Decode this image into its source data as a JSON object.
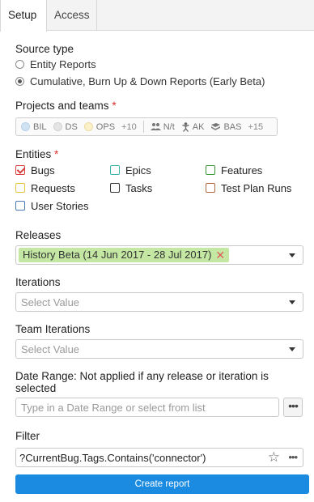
{
  "tabs": [
    {
      "label": "Setup"
    },
    {
      "label": "Access"
    }
  ],
  "source_type": {
    "label": "Source type",
    "options": [
      {
        "label": "Entity Reports",
        "checked": false
      },
      {
        "label": "Cumulative, Burn Up & Down Reports (Early Beta)",
        "checked": true
      }
    ]
  },
  "projects": {
    "label": "Projects and teams",
    "required_mark": "*",
    "items": [
      {
        "label": "BIL",
        "color": "#cfe3f5"
      },
      {
        "label": "DS",
        "color": "#e2e2e2"
      },
      {
        "label": "OPS",
        "color": "#fbf0c8"
      }
    ],
    "more_projects": "+10",
    "teams": [
      {
        "label": "N/t",
        "icon": "team-icon"
      },
      {
        "label": "AK",
        "icon": "person-icon"
      },
      {
        "label": "BAS",
        "icon": "book-icon"
      }
    ],
    "more_teams": "+15"
  },
  "entities": {
    "label": "Entities",
    "required_mark": "*",
    "items": [
      {
        "label": "Bugs",
        "color": "#d94141",
        "checked": true
      },
      {
        "label": "Epics",
        "color": "#3ab6a8",
        "checked": false
      },
      {
        "label": "Features",
        "color": "#3a9a3a",
        "checked": false
      },
      {
        "label": "Requests",
        "color": "#e8c43a",
        "checked": false
      },
      {
        "label": "Tasks",
        "color": "#333333",
        "checked": false
      },
      {
        "label": "Test Plan Runs",
        "color": "#b06a3a",
        "checked": false
      },
      {
        "label": "User Stories",
        "color": "#4a7ab8",
        "checked": false
      }
    ]
  },
  "releases": {
    "label": "Releases",
    "selected": "History Beta (14 Jun 2017 - 28 Jul 2017)"
  },
  "iterations": {
    "label": "Iterations",
    "placeholder": "Select Value"
  },
  "team_iterations": {
    "label": "Team Iterations",
    "placeholder": "Select Value"
  },
  "date_range": {
    "label": "Date Range: Not applied if any release or iteration is selected",
    "placeholder": "Type in a Date Range or select from list",
    "more": "•••"
  },
  "filter": {
    "label": "Filter",
    "value": "?CurrentBug.Tags.Contains('connector')",
    "star": "☆",
    "more": "•••"
  },
  "create_button": "Create report"
}
